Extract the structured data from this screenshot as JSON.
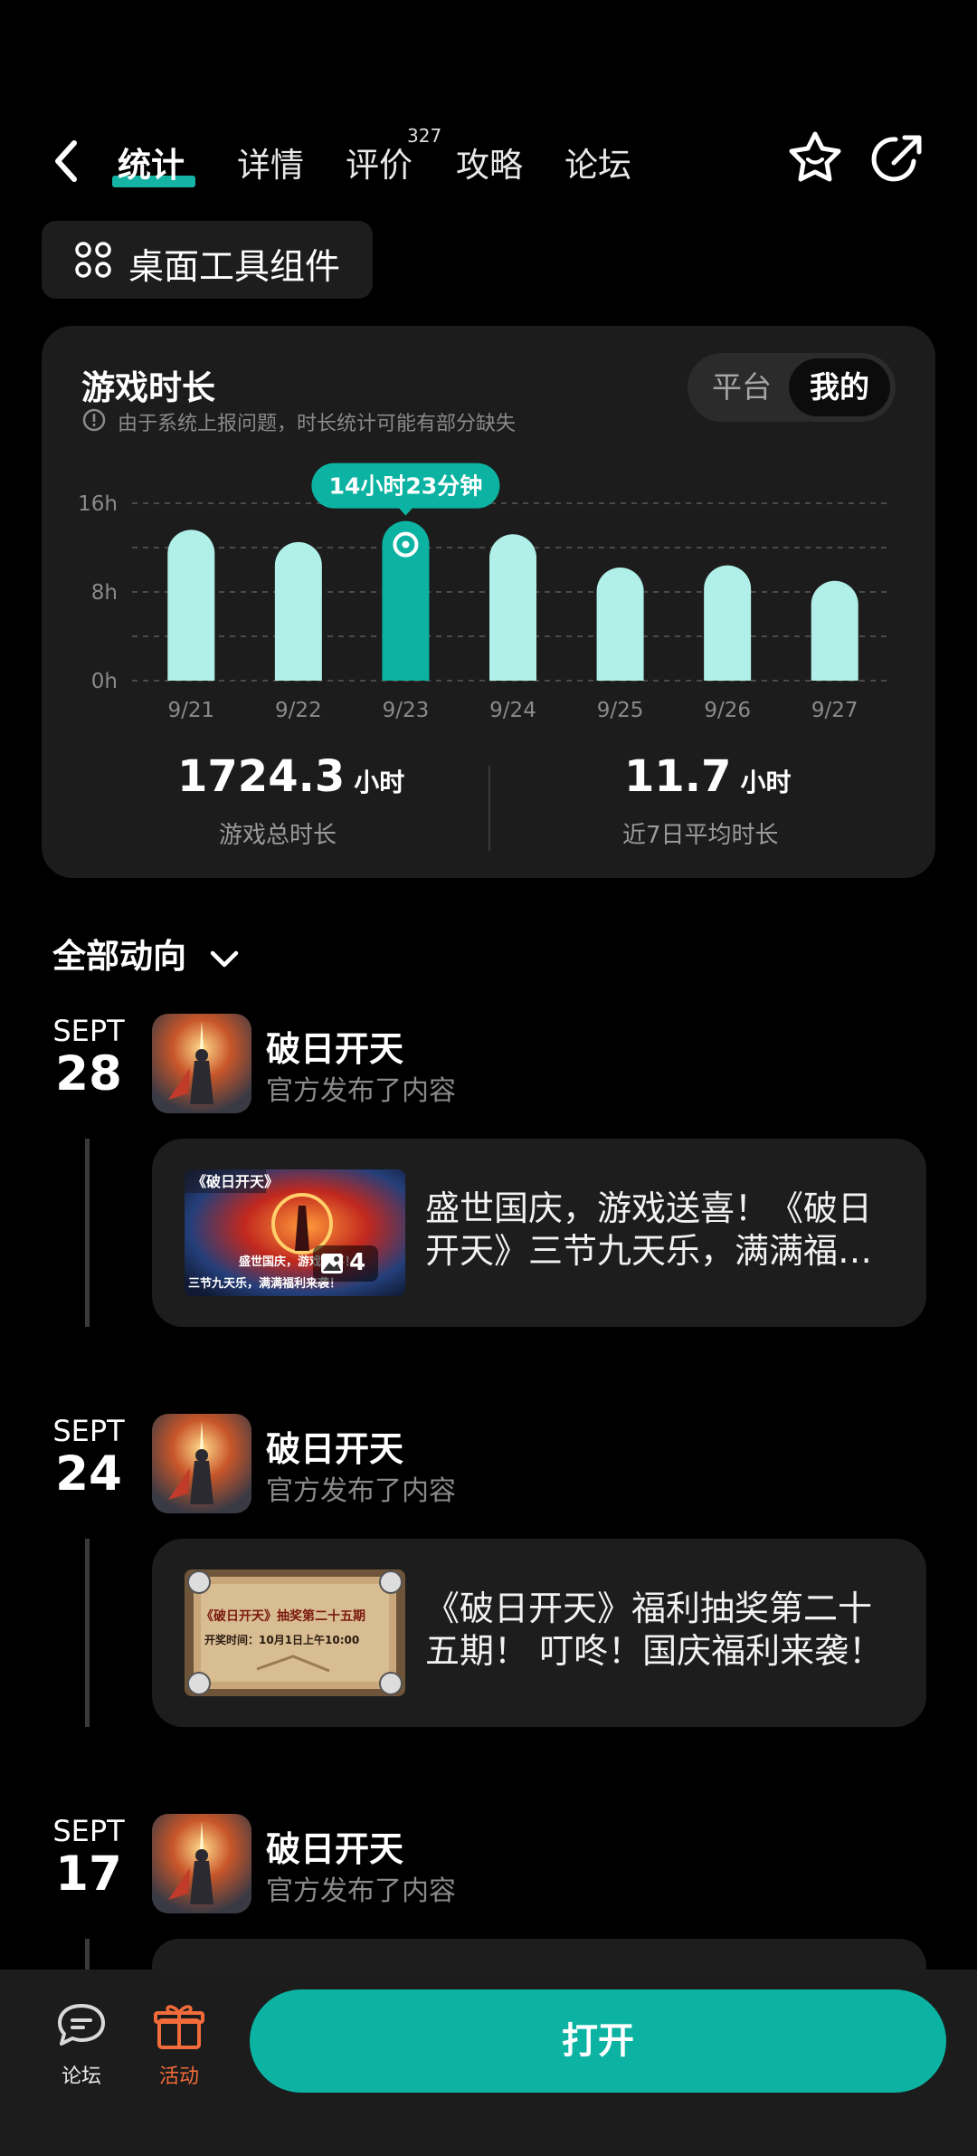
{
  "header": {
    "tabs": [
      {
        "label": "统计"
      },
      {
        "label": "详情"
      },
      {
        "label": "评价"
      },
      {
        "label": "攻略"
      },
      {
        "label": "论坛"
      }
    ],
    "review_count": "327"
  },
  "widget": {
    "label": "桌面工具组件"
  },
  "stats": {
    "title": "游戏时长",
    "note": "由于系统上报问题，时长统计可能有部分缺失",
    "toggle": {
      "off": "平台",
      "on": "我的"
    },
    "tooltip": "14小时23分钟",
    "total_value": "1724.3",
    "total_unit": "小时",
    "total_label": "游戏总时长",
    "avg_value": "11.7",
    "avg_unit": "小时",
    "avg_label": "近7日平均时长"
  },
  "chart_data": {
    "type": "bar",
    "categories": [
      "9/21",
      "9/22",
      "9/23",
      "9/24",
      "9/25",
      "9/26",
      "9/27"
    ],
    "values": [
      13.6,
      12.5,
      14.4,
      13.2,
      10.2,
      10.4,
      9.0
    ],
    "yticks": [
      "0h",
      "8h",
      "16h"
    ],
    "ylim": [
      0,
      16
    ],
    "highlight_index": 2,
    "colors": {
      "bar": "#b0f0e8",
      "highlight": "#0db3a2"
    }
  },
  "feed": {
    "title": "全部动向",
    "posts": [
      {
        "month": "SEPT",
        "day": "28",
        "game": "破日开天",
        "sub": "官方发布了内容",
        "text": "盛世国庆，游戏送喜！《破日开天》三节九天乐，满满福利来袭！",
        "image_count": "4",
        "thumb_title": "《破日开天》",
        "thumb_line1": "盛世国庆，游戏送喜！",
        "thumb_line2": "三节九天乐，满满福利来袭！"
      },
      {
        "month": "SEPT",
        "day": "24",
        "game": "破日开天",
        "sub": "官方发布了内容",
        "text": "《破日开天》福利抽奖第二十五期！ 叮咚！国庆福利来袭！",
        "thumb_title": "《破日开天》抽奖第二十五期",
        "thumb_line1": "开奖时间：10月1日上午10:00"
      },
      {
        "month": "SEPT",
        "day": "17",
        "game": "破日开天",
        "sub": "官方发布了内容"
      }
    ]
  },
  "bottom": {
    "forum_label": "论坛",
    "activity_label": "活动",
    "open_label": "打开"
  }
}
